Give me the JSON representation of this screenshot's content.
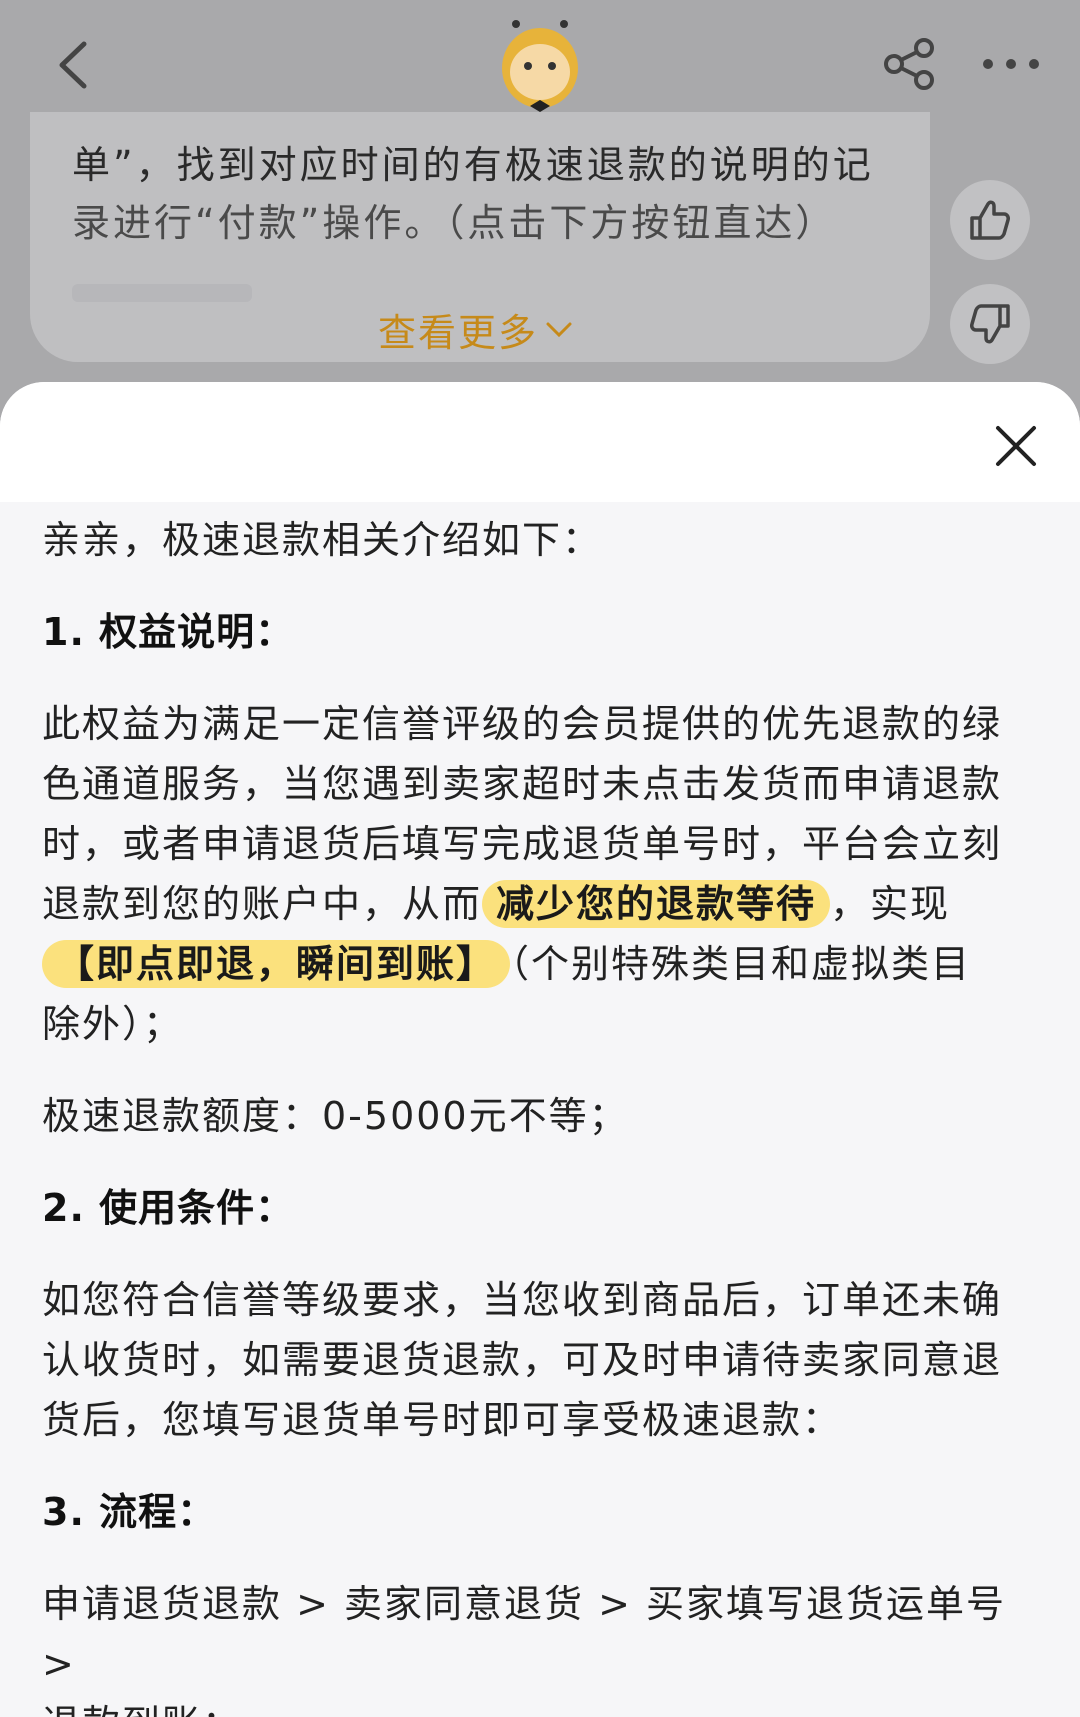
{
  "nav": {
    "icons": [
      "back-arrow-icon",
      "mascot-logo",
      "share-icon",
      "more-icon"
    ]
  },
  "bg_card": {
    "line1": "单”，找到对应时间的有极速退款的说明的记",
    "line2": "录进行“付款”操作。（点击下方按钮直达）",
    "more_label": "查看更多"
  },
  "feedback": {
    "like_icon": "thumbs-up-icon",
    "dislike_icon": "thumbs-down-icon"
  },
  "sheet": {
    "intro": "亲亲，极速退款相关介绍如下：",
    "section1": {
      "title": "1. 权益说明：",
      "para_line1": "此权益为满足一定信誉评级的会员提供的优先退款的绿",
      "para_line2": "色通道服务，当您遇到卖家超时未点击发货而申请退款",
      "para_line3": "时，或者申请退货后填写完成退货单号时，平台会立刻",
      "para_line4_pre": "退款到您的账户中，从而",
      "highlight1": "减少您的退款等待",
      "para_line4_post": "，实现",
      "highlight2": "【即点即退，瞬间到账】",
      "para_line5_post": "（个别特殊类目和虚拟类目",
      "para_line6": "除外）；",
      "quota": "极速退款额度：0-5000元不等；"
    },
    "section2": {
      "title": "2. 使用条件：",
      "line1": "如您符合信誉等级要求，当您收到商品后，订单还未确",
      "line2": "认收货时，如需要退货退款，可及时申请待卖家同意退",
      "line3": "货后，您填写退货单号时即可享受极速退款："
    },
    "section3": {
      "title": "3. 流程：",
      "line1": "申请退货退款 > 卖家同意退货 > 买家填写退货运单号 >",
      "line2": "退款到账；"
    }
  }
}
